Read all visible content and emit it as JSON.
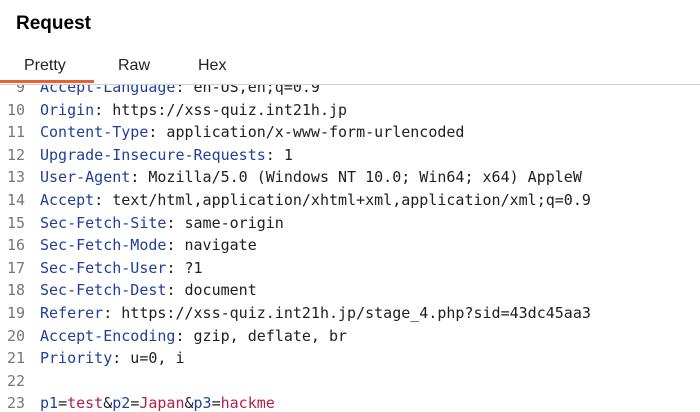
{
  "panel": {
    "title": "Request"
  },
  "tabs": [
    {
      "label": "Pretty",
      "active": true
    },
    {
      "label": "Raw",
      "active": false
    },
    {
      "label": "Hex",
      "active": false
    }
  ],
  "colors": {
    "accent": "#e8622d",
    "header_name": "#1f3f9a",
    "param_value": "#b0204a"
  },
  "lines": [
    {
      "n": "9",
      "name": "Accept-Language",
      "value": " en-US,en;q=0.9"
    },
    {
      "n": "10",
      "name": "Origin",
      "value": " https://xss-quiz.int21h.jp"
    },
    {
      "n": "11",
      "name": "Content-Type",
      "value": " application/x-www-form-urlencoded"
    },
    {
      "n": "12",
      "name": "Upgrade-Insecure-Requests",
      "value": " 1"
    },
    {
      "n": "13",
      "name": "User-Agent",
      "value": " Mozilla/5.0 (Windows NT 10.0; Win64; x64) AppleW"
    },
    {
      "n": "14",
      "name": "Accept",
      "value": " text/html,application/xhtml+xml,application/xml;q=0.9"
    },
    {
      "n": "15",
      "name": "Sec-Fetch-Site",
      "value": " same-origin"
    },
    {
      "n": "16",
      "name": "Sec-Fetch-Mode",
      "value": " navigate"
    },
    {
      "n": "17",
      "name": "Sec-Fetch-User",
      "value": " ?1"
    },
    {
      "n": "18",
      "name": "Sec-Fetch-Dest",
      "value": " document"
    },
    {
      "n": "19",
      "name": "Referer",
      "value": " https://xss-quiz.int21h.jp/stage_4.php?sid=43dc45aa3"
    },
    {
      "n": "20",
      "name": "Accept-Encoding",
      "value": " gzip, deflate, br"
    },
    {
      "n": "21",
      "name": "Priority",
      "value": " u=0, i"
    },
    {
      "n": "22",
      "name": "",
      "value": ""
    }
  ],
  "body_line": {
    "n": "23",
    "params": [
      {
        "name": "p1",
        "value": "test"
      },
      {
        "name": "p2",
        "value": "Japan"
      },
      {
        "name": "p3",
        "value": "hackme"
      }
    ]
  }
}
